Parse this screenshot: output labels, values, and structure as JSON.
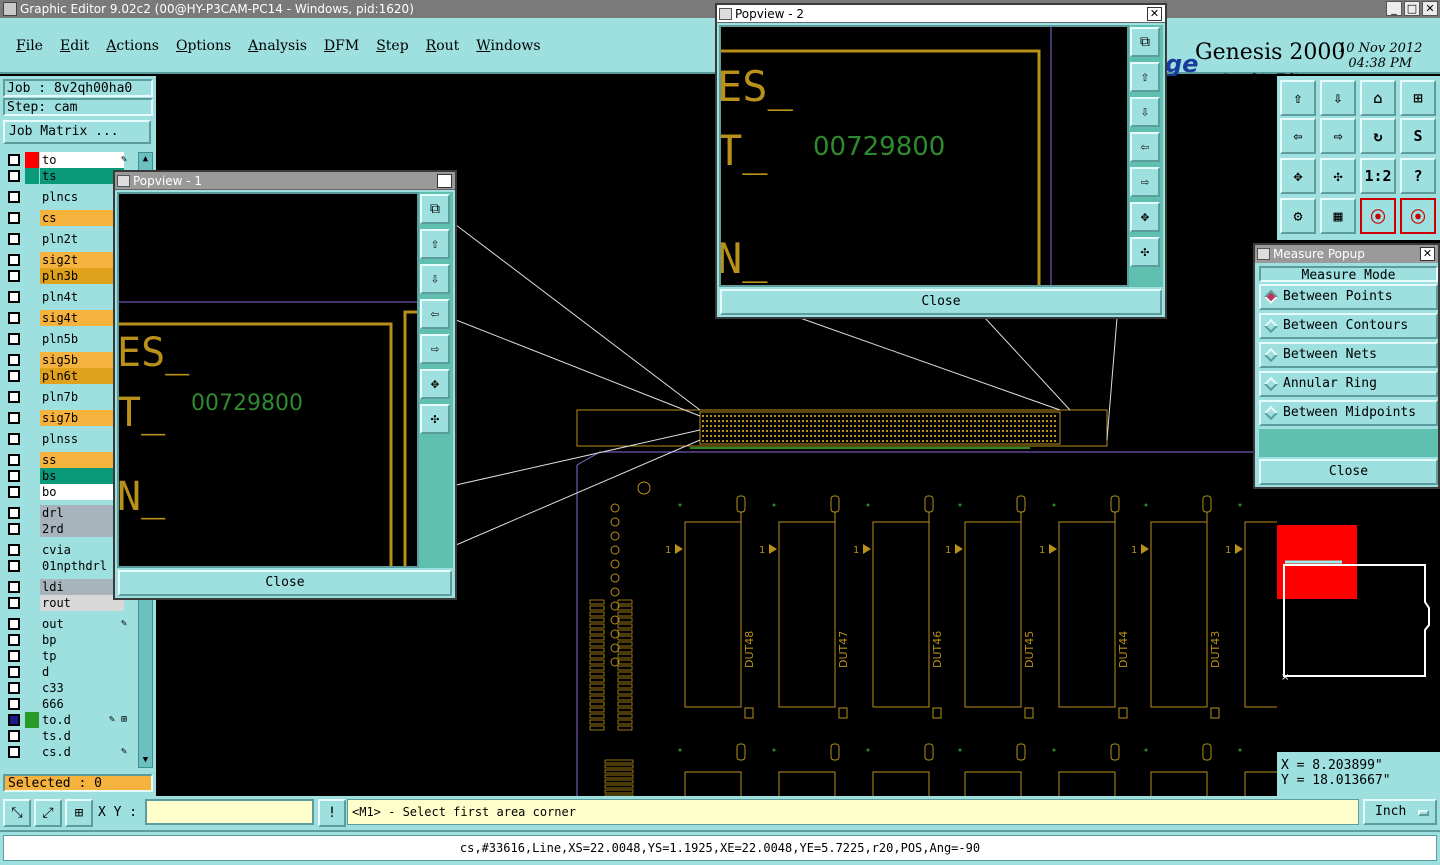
{
  "window": {
    "title": "Graphic Editor 9.02c2 (00@HY-P3CAM-PC14 - Windows, pid:1620)"
  },
  "menu": [
    "File",
    "Edit",
    "Actions",
    "Options",
    "Analysis",
    "DFM",
    "Step",
    "Rout",
    "Windows"
  ],
  "brand": {
    "logo_fragment": "ge",
    "product": "Genesis 2000",
    "subtitle": "Graphic Editor",
    "date": "10 Nov 2012",
    "time": "04:38 PM"
  },
  "job": {
    "job": "Job : 8v2qh00ha0",
    "step": "Step: cam",
    "matrix_button": "Job Matrix ..."
  },
  "layers": [
    {
      "name": "to",
      "color": "#ff0000",
      "bg": "#ffffff",
      "mark": "✎"
    },
    {
      "name": "ts",
      "color": "#0a9a7a",
      "bg": "#0a9a7a",
      "mark": ""
    },
    {
      "name": "plncs",
      "color": "",
      "bg": "#9edfdf",
      "mark": ""
    },
    {
      "name": "cs",
      "color": "",
      "bg": "#f5b23c",
      "mark": ""
    },
    {
      "name": "pln2t",
      "color": "",
      "bg": "#9edfdf",
      "mark": ""
    },
    {
      "name": "sig2t",
      "color": "",
      "bg": "#f5b23c",
      "mark": ""
    },
    {
      "name": "pln3b",
      "color": "",
      "bg": "#e0a21c",
      "mark": ""
    },
    {
      "name": "pln4t",
      "color": "",
      "bg": "#9edfdf",
      "mark": ""
    },
    {
      "name": "sig4t",
      "color": "",
      "bg": "#f5b23c",
      "mark": ""
    },
    {
      "name": "pln5b",
      "color": "",
      "bg": "#9edfdf",
      "mark": ""
    },
    {
      "name": "sig5b",
      "color": "",
      "bg": "#f5b23c",
      "mark": ""
    },
    {
      "name": "pln6t",
      "color": "",
      "bg": "#e0a21c",
      "mark": ""
    },
    {
      "name": "pln7b",
      "color": "",
      "bg": "#9edfdf",
      "mark": ""
    },
    {
      "name": "sig7b",
      "color": "",
      "bg": "#f5b23c",
      "mark": ""
    },
    {
      "name": "plnss",
      "color": "",
      "bg": "#9edfdf",
      "mark": ""
    },
    {
      "name": "ss",
      "color": "",
      "bg": "#f5b23c",
      "mark": ""
    },
    {
      "name": "bs",
      "color": "",
      "bg": "#0a9a7a",
      "mark": ""
    },
    {
      "name": "bo",
      "color": "",
      "bg": "#ffffff",
      "mark": ""
    },
    {
      "name": "drl",
      "color": "",
      "bg": "#a8b4bc",
      "mark": ""
    },
    {
      "name": "2rd",
      "color": "",
      "bg": "#a8b4bc",
      "mark": ""
    },
    {
      "name": "cvia",
      "color": "",
      "bg": "#9edfdf",
      "mark": ""
    },
    {
      "name": "01npthdrl",
      "color": "",
      "bg": "#9edfdf",
      "mark": ""
    },
    {
      "name": "ldi",
      "color": "",
      "bg": "#a8b4bc",
      "mark": ""
    },
    {
      "name": "rout",
      "color": "",
      "bg": "#d8d8d8",
      "mark": ""
    },
    {
      "name": "out",
      "color": "",
      "bg": "#9edfdf",
      "mark": "✎"
    },
    {
      "name": "bp",
      "color": "",
      "bg": "#9edfdf",
      "mark": ""
    },
    {
      "name": "tp",
      "color": "",
      "bg": "#9edfdf",
      "mark": ""
    },
    {
      "name": "d",
      "color": "",
      "bg": "#9edfdf",
      "mark": ""
    },
    {
      "name": "c33",
      "color": "",
      "bg": "#9edfdf",
      "mark": ""
    },
    {
      "name": "666",
      "color": "",
      "bg": "#9edfdf",
      "mark": ""
    },
    {
      "name": "to.d",
      "color": "#2a9a2a",
      "bg": "#9edfdf",
      "mark": "✎ ⊞"
    },
    {
      "name": "ts.d",
      "color": "",
      "bg": "#9edfdf",
      "mark": ""
    },
    {
      "name": "cs.d",
      "color": "",
      "bg": "#9edfdf",
      "mark": "✎"
    }
  ],
  "selected": "Selected : 0",
  "popview1": {
    "title": "Popview - 1",
    "close": "Close",
    "serial": "00729800",
    "text1": "ES_",
    "text2": "T_",
    "text3": "N_"
  },
  "popview2": {
    "title": "Popview - 2",
    "close": "Close",
    "serial": "00729800",
    "text1": "ES_",
    "text2": "T_",
    "text3": "N_"
  },
  "measure": {
    "title": "Measure Popup",
    "mode_label": "Measure Mode",
    "options": [
      "Between Points",
      "Between Contours",
      "Between Nets",
      "Annular Ring",
      "Between Midpoints"
    ],
    "selected_index": 0,
    "close": "Close"
  },
  "coords": {
    "x": "X = 8.203899\"",
    "y": "Y = 18.013667\""
  },
  "bottom": {
    "xy_label": "X Y :",
    "xy_value": "",
    "prompt": "<M1> - Select first area corner",
    "units": "Inch"
  },
  "status": "cs,#33616,Line,XS=22.0048,YS=1.1925,XE=22.0048,YE=5.7225,r20,POS,Ang=-90",
  "canvas": {
    "dut_labels": [
      "DUT48",
      "DUT47",
      "DUT46",
      "DUT45",
      "DUT44",
      "DUT43"
    ],
    "pin_label": "1"
  },
  "colors": {
    "panel": "#9edfdf",
    "trace": "#b8901a",
    "outline": "#8a6ad8"
  }
}
